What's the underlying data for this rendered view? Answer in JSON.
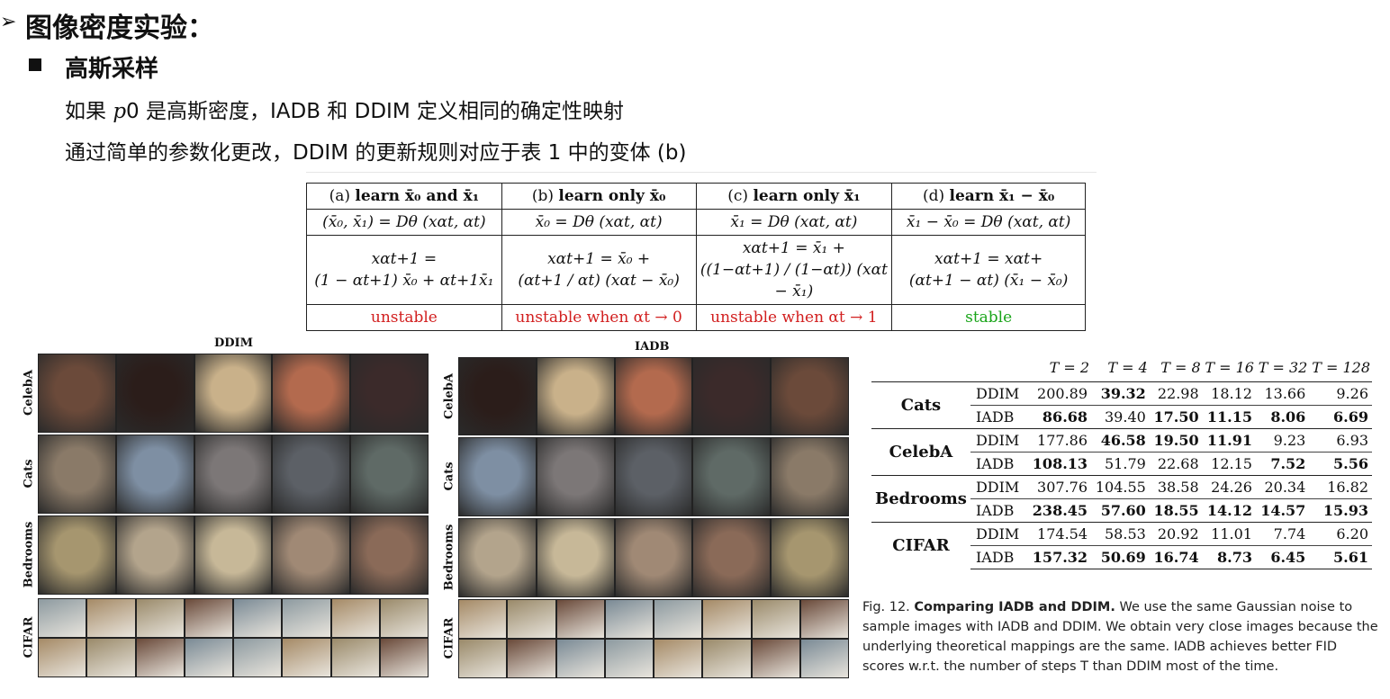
{
  "heading": {
    "arrow": "➢",
    "title": "图像密度实验："
  },
  "subheading": "高斯采样",
  "lines": {
    "line1_pre": "如果 ",
    "line1_math": "p",
    "line1_post": "0 是高斯密度，IADB 和 DDIM 定义相同的确定性映射",
    "line2": "通过简单的参数化更改，DDIM 的更新规则对应于表 1 中的变体 (b)"
  },
  "variants": {
    "headers": [
      {
        "pre": "(a) ",
        "bold": "learn x̄₀ and x̄₁"
      },
      {
        "pre": "(b) ",
        "bold": "learn only x̄₀"
      },
      {
        "pre": "(c) ",
        "bold": "learn only x̄₁"
      },
      {
        "pre": "(d) ",
        "bold": "learn x̄₁ − x̄₀"
      }
    ],
    "params": [
      "(x̄₀, x̄₁) = Dθ (xαt, αt)",
      "x̄₀ = Dθ (xαt, αt)",
      "x̄₁ = Dθ (xαt, αt)",
      "x̄₁ − x̄₀ = Dθ (xαt, αt)"
    ],
    "updates_1": [
      "xαt+1 =",
      "xαt+1 = x̄₀ +",
      "xαt+1 = x̄₁ +",
      "xαt+1 = xαt+"
    ],
    "updates_2": [
      "(1 − αt+1) x̄₀ + αt+1x̄₁",
      "(αt+1 / αt) (xαt − x̄₀)",
      "((1−αt+1) / (1−αt)) (xαt − x̄₁)",
      "(αt+1 − αt) (x̄₁ − x̄₀)"
    ],
    "stability": [
      "unstable",
      "unstable when αt → 0",
      "unstable when αt → 1",
      "stable"
    ]
  },
  "grids": {
    "left_title": "DDIM",
    "right_title": "IADB",
    "row_labels": [
      "CelebA",
      "Cats",
      "Bedrooms",
      "CIFAR"
    ]
  },
  "results": {
    "steps": [
      "T = 2",
      "T = 4",
      "T = 8",
      "T = 16",
      "T = 32",
      "T = 128"
    ],
    "rows": [
      {
        "dataset": "Cats",
        "ddim": [
          "200.89",
          "39.32",
          "22.98",
          "18.12",
          "13.66",
          "9.26"
        ],
        "iadb": [
          "86.68",
          "39.40",
          "17.50",
          "11.15",
          "8.06",
          "6.69"
        ]
      },
      {
        "dataset": "CelebA",
        "ddim": [
          "177.86",
          "46.58",
          "19.50",
          "11.91",
          "9.23",
          "6.93"
        ],
        "iadb": [
          "108.13",
          "51.79",
          "22.68",
          "12.15",
          "7.52",
          "5.56"
        ]
      },
      {
        "dataset": "Bedrooms",
        "ddim": [
          "307.76",
          "104.55",
          "38.58",
          "24.26",
          "20.34",
          "16.82"
        ],
        "iadb": [
          "238.45",
          "57.60",
          "18.55",
          "14.12",
          "14.57",
          "15.93"
        ]
      },
      {
        "dataset": "CIFAR",
        "ddim": [
          "174.54",
          "58.53",
          "20.92",
          "11.01",
          "7.74",
          "6.20"
        ],
        "iadb": [
          "157.32",
          "50.69",
          "16.74",
          "8.73",
          "6.45",
          "5.61"
        ]
      }
    ],
    "method_ddim": "DDIM",
    "method_iadb": "IADB"
  },
  "caption": {
    "prefix": "Fig. 12.  ",
    "bold": "Comparing IADB and DDIM.",
    "text": " We use the same Gaussian noise to sample images with IADB and DDIM. We obtain very close images because the underlying theoretical mappings are the same. IADB achieves better FID scores w.r.t. the number of steps T than DDIM most of the time."
  }
}
